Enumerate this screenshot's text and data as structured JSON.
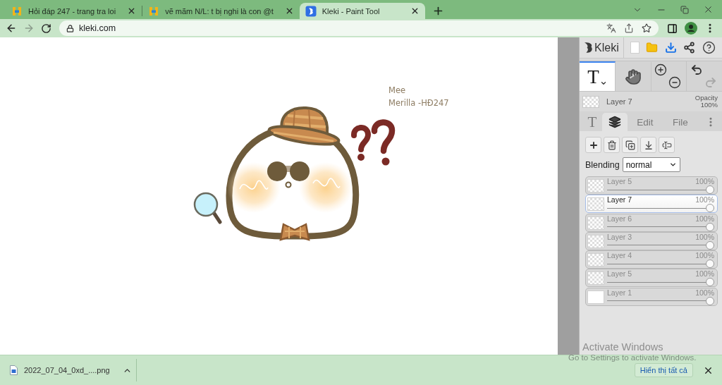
{
  "browser": {
    "tabs": [
      {
        "kind": "hoidap",
        "title": "Hỏi đáp 247 - trang tra loi",
        "selected": false
      },
      {
        "kind": "hoidap",
        "title": "vẽ mãm N/L: t bị nghi là con @t",
        "selected": false
      },
      {
        "kind": "kleki",
        "title": "Kleki - Paint Tool",
        "selected": true
      }
    ],
    "nav": [
      {
        "kind": "back",
        "disabled": false
      },
      {
        "kind": "forward",
        "disabled": true
      },
      {
        "kind": "reload",
        "disabled": false
      }
    ],
    "address": {
      "url": "kleki.com"
    }
  },
  "canvas": {
    "notes": [
      "Mee",
      "Merilla -HĐ247"
    ]
  },
  "panel": {
    "logo": "Kleki",
    "tools": [
      {
        "kind": "text",
        "glyph": "T",
        "selected": true
      },
      {
        "kind": "hand",
        "selected": false
      }
    ],
    "history": [
      {
        "kind": "undo",
        "disabled": false
      },
      {
        "kind": "redo",
        "disabled": true
      }
    ],
    "current_layer": {
      "name": "Layer 7",
      "opacity_label": "Opacity",
      "opacity": "100%"
    },
    "tabs": [
      {
        "kind": "glyph",
        "text": "T",
        "selected": false
      },
      {
        "kind": "layers",
        "selected": true
      },
      {
        "kind": "label",
        "text": "Edit",
        "selected": false
      },
      {
        "kind": "label",
        "text": "File",
        "selected": false
      }
    ],
    "blending": {
      "label": "Blending",
      "value": "normal"
    },
    "layers": [
      {
        "kind": "transparent",
        "name": "Layer 5",
        "opacity": "100%",
        "level": 1,
        "selected": false
      },
      {
        "kind": "transparent",
        "name": "Layer 7",
        "opacity": "100%",
        "level": 1,
        "selected": true
      },
      {
        "kind": "transparent",
        "name": "Layer 6",
        "opacity": "100%",
        "level": 1,
        "selected": false
      },
      {
        "kind": "transparent",
        "name": "Layer 3",
        "opacity": "100%",
        "level": 1,
        "selected": false
      },
      {
        "kind": "transparent",
        "name": "Layer 4",
        "opacity": "100%",
        "level": 1,
        "selected": false
      },
      {
        "kind": "transparent",
        "name": "Layer 5",
        "opacity": "100%",
        "level": 1,
        "selected": false
      },
      {
        "kind": "filled",
        "name": "Layer 1",
        "opacity": "100%",
        "level": 1,
        "selected": false
      }
    ]
  },
  "downloads": {
    "file": "2022_07_04_0xd_....png",
    "show_all": "Hiển thị tất cả"
  },
  "os_notice": {
    "title": "Activate Windows",
    "text": "Go to Settings to activate Windows."
  }
}
